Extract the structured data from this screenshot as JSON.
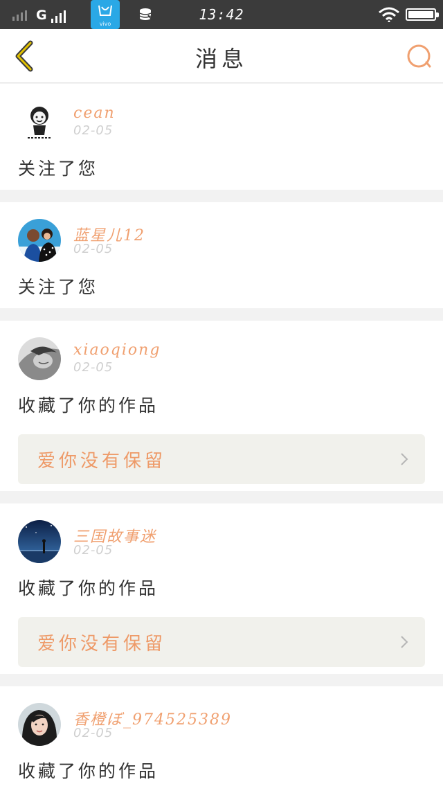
{
  "status_bar": {
    "carrier": "G",
    "vivo_label": "vivo",
    "time": "13:42"
  },
  "header": {
    "title": "消息"
  },
  "messages": [
    {
      "user": "cean",
      "date": "02-05",
      "action": "关注了您",
      "avatar_icon": "meme-face-avatar"
    },
    {
      "user": "蓝星儿12",
      "date": "02-05",
      "action": "关注了您",
      "avatar_icon": "couple-photo-avatar"
    },
    {
      "user": "xiaoqiong",
      "date": "02-05",
      "action": "收藏了你的作品",
      "work_title": "爱你没有保留",
      "avatar_icon": "grayscale-portrait-avatar"
    },
    {
      "user": "三国故事迷",
      "date": "02-05",
      "action": "收藏了你的作品",
      "work_title": "爱你没有保留",
      "avatar_icon": "night-sky-avatar"
    },
    {
      "user": "香橙ぼ_974525389",
      "date": "02-05",
      "action": "收藏了你的作品",
      "avatar_icon": "portrait-avatar"
    }
  ],
  "colors": {
    "accent": "#f0a070",
    "work_bg": "#f1f1ec",
    "status_bg": "#3b3b3b",
    "back_arrow": "#e2c200"
  }
}
